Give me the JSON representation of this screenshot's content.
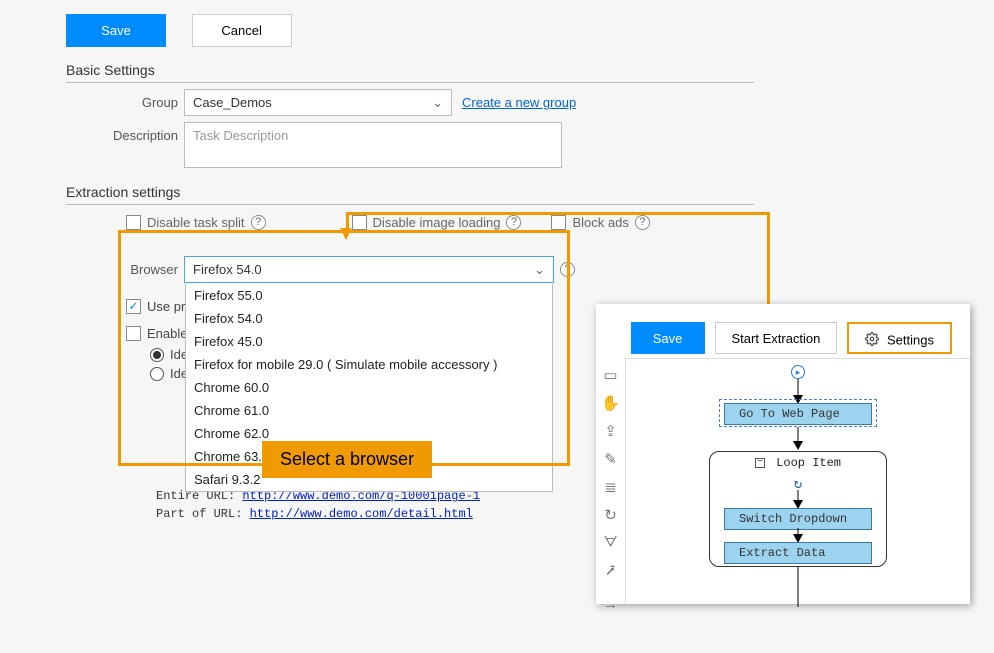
{
  "top": {
    "save": "Save",
    "cancel": "Cancel"
  },
  "basic": {
    "title": "Basic Settings",
    "groupLabel": "Group",
    "groupValue": "Case_Demos",
    "createGroup": "Create a new group",
    "descriptionLabel": "Description",
    "descriptionPlaceholder": "Task Description"
  },
  "extraction": {
    "title": "Extraction settings",
    "disableTaskSplit": "Disable task split",
    "disableImageLoading": "Disable image loading",
    "blockAds": "Block ads",
    "browserLabel": "Browser",
    "browserSelected": "Firefox 54.0",
    "browserOptions": {
      "o0": "Firefox 55.0",
      "o1": "Firefox 54.0",
      "o2": "Firefox 45.0",
      "o3": "Firefox for mobile 29.0 ( Simulate mobile accessory )",
      "o4": "Chrome 60.0",
      "o5": "Chrome 61.0",
      "o6": "Chrome 62.0",
      "o7": "Chrome 63.0",
      "o8": "Safari 9.3.2"
    },
    "usePro": "Use pro",
    "enableI": "Enable I",
    "identi1": "Identi",
    "identi2": "Identi",
    "entireUrlLabel": "Entire URL: ",
    "entireUrlLink": "http://www.demo.com/q-10001page-1",
    "partUrlLabel": "Part of URL: ",
    "partUrlLink": "http://www.demo.com/detail.html"
  },
  "callout": "Select a browser",
  "rightPanel": {
    "save": "Save",
    "startExtraction": "Start Extraction",
    "settings": "Settings",
    "goToWebPage": "Go To Web Page",
    "loopItem": "Loop Item",
    "switchDropdown": "Switch Dropdown",
    "extractData": "Extract Data"
  }
}
